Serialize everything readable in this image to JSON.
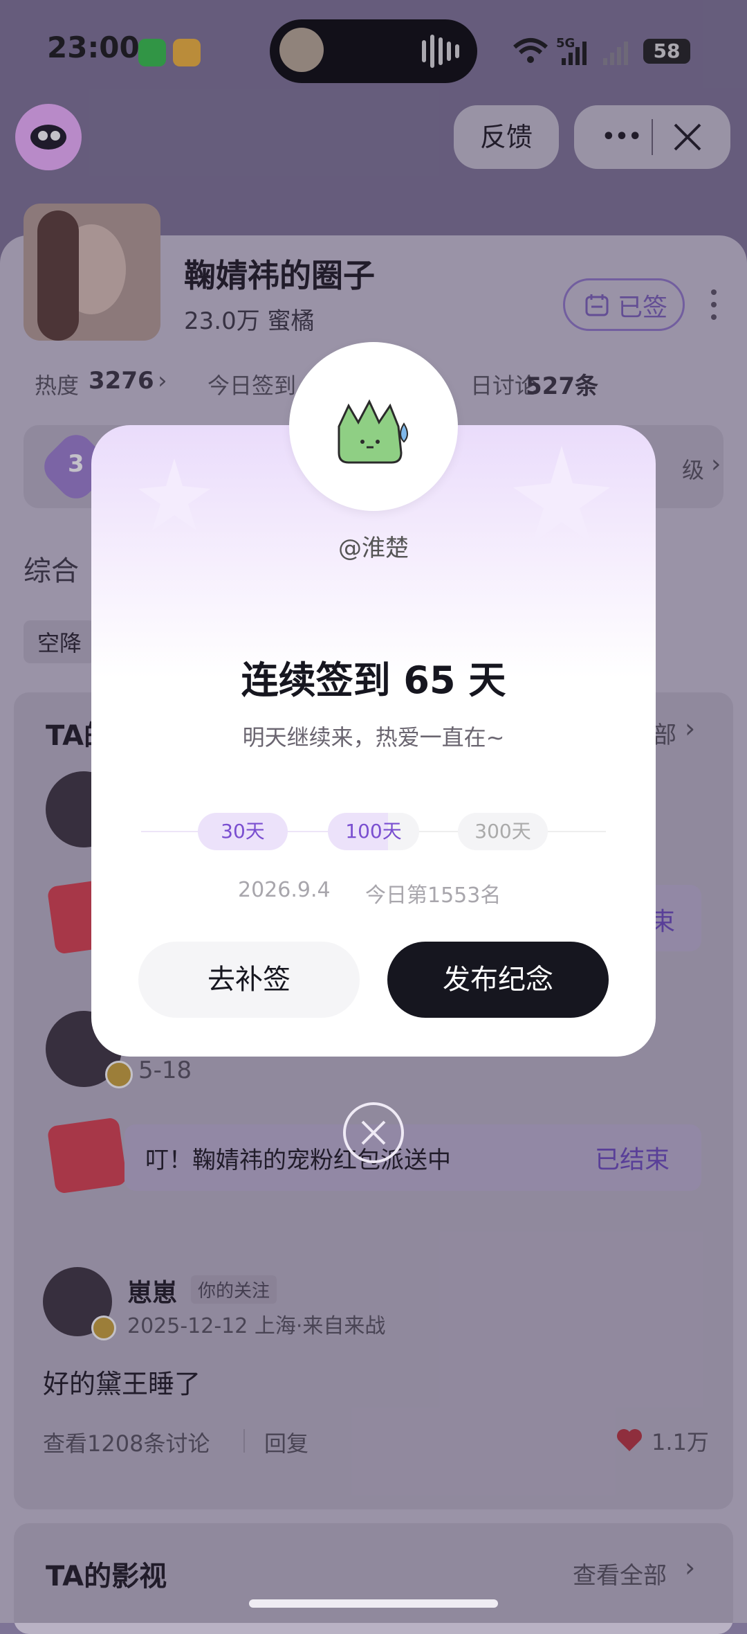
{
  "status_bar": {
    "time": "23:00",
    "battery": "58",
    "network": "5G"
  },
  "header": {
    "feedback_label": "反馈",
    "more_label": "•••"
  },
  "circle": {
    "name": "鞠婧祎的圈子",
    "members": "23.0万 蜜橘",
    "signed_label": "已签",
    "stats": {
      "heat_label": "热度",
      "heat_value": "3276",
      "today_sign_label": "今日签到",
      "today_discuss_label": "日讨论",
      "today_discuss_value": "527条"
    },
    "level_right": "级",
    "level_badge": "3"
  },
  "tabs": {
    "main_tab": "综合",
    "chip": "空降"
  },
  "section_ta": {
    "title_partial": "TA的",
    "more_partial": "部"
  },
  "posts": [
    {
      "date": "5-18"
    },
    {
      "author": "崽崽",
      "tag": "你的关注",
      "meta": "2025-12-12 上海·来自来战",
      "content": "好的黛王睡了",
      "view_discussions": "查看1208条讨论",
      "reply": "回复",
      "likes": "1.1万"
    }
  ],
  "redpack_banners": [
    {
      "text": "",
      "status_partial": "束"
    },
    {
      "text": "叮！鞠婧祎的宠粉红包派送中",
      "status": "已结束"
    }
  ],
  "films": {
    "title": "TA的影视",
    "see_all": "查看全部"
  },
  "modal": {
    "username": "@淮楚",
    "headline": "连续签到 65 天",
    "subtitle": "明天继续来，热爱一直在~",
    "milestones": [
      "30天",
      "100天",
      "300天"
    ],
    "progress": 0.45,
    "date": "2026.9.4",
    "rank": "今日第1553名",
    "makeup_label": "去补签",
    "publish_label": "发布纪念"
  },
  "colors": {
    "accent_purple": "#7a4fd0",
    "dark_button": "#16161f",
    "like_red": "#e0304a"
  }
}
